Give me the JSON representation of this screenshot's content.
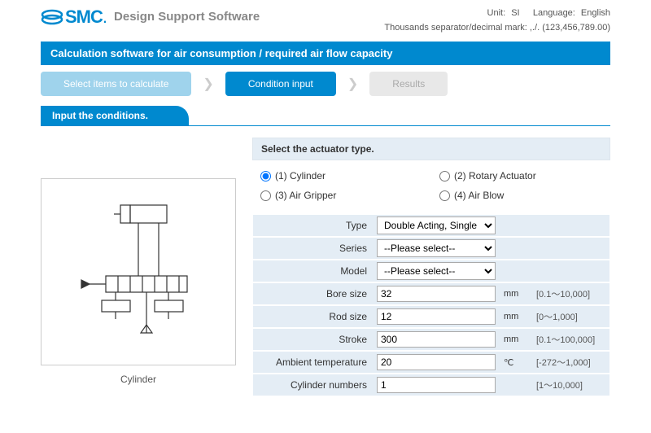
{
  "header": {
    "logo_text": "SMC",
    "app_title": "Design Support Software",
    "unit_label": "Unit:",
    "unit_value": "SI",
    "lang_label": "Language:",
    "lang_value": "English",
    "separator_label": "Thousands separator/decimal mark: ,./. (123,456,789.00)"
  },
  "page_title": "Calculation software for air consumption / required air flow capacity",
  "steps": {
    "s1": "Select items to calculate",
    "s2": "Condition input",
    "s3": "Results"
  },
  "section_tab": "Input the conditions.",
  "diagram_caption": "Cylinder",
  "actuator": {
    "header": "Select the actuator type.",
    "opts": {
      "o1": "(1) Cylinder",
      "o2": "(2) Rotary Actuator",
      "o3": "(3) Air Gripper",
      "o4": "(4) Air Blow"
    }
  },
  "form": {
    "type": {
      "label": "Type",
      "value": "Double Acting, Single Rod"
    },
    "series": {
      "label": "Series",
      "value": "--Please select--"
    },
    "model": {
      "label": "Model",
      "value": "--Please select--"
    },
    "bore": {
      "label": "Bore size",
      "value": "32",
      "unit": "mm",
      "range": "[0.1～10,000]"
    },
    "rod": {
      "label": "Rod size",
      "value": "12",
      "unit": "mm",
      "range": "[0～1,000]"
    },
    "stroke": {
      "label": "Stroke",
      "value": "300",
      "unit": "mm",
      "range": "[0.1～100,000]"
    },
    "temp": {
      "label": "Ambient temperature",
      "value": "20",
      "unit": "℃",
      "range": "[-272～1,000]"
    },
    "cylnum": {
      "label": "Cylinder numbers",
      "value": "1",
      "unit": "",
      "range": "[1～10,000]"
    }
  }
}
